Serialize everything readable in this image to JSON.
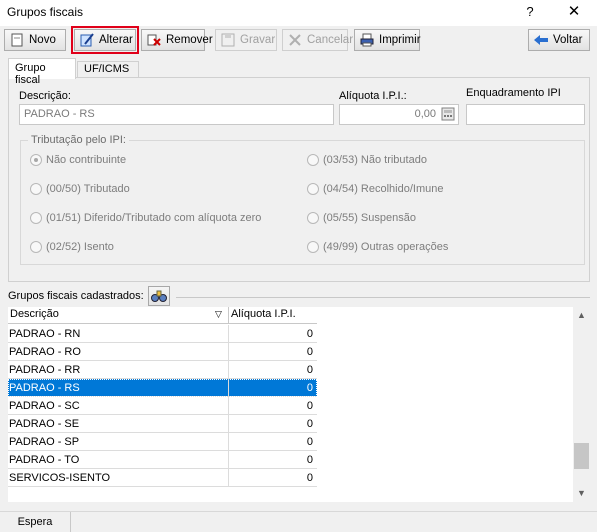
{
  "window": {
    "title": "Grupos fiscais",
    "help": "?",
    "close": "✕"
  },
  "toolbar": {
    "novo": "Novo",
    "alterar": "Alterar",
    "remover": "Remover",
    "gravar": "Gravar",
    "cancelar": "Cancelar",
    "imprimir": "Imprimir",
    "voltar": "Voltar"
  },
  "tabs": [
    "Grupo fiscal",
    "UF/ICMS"
  ],
  "form": {
    "descricao_label": "Descrição:",
    "descricao_value": "PADRAO - RS",
    "aliquota_label": "Alíquota I.P.I.:",
    "aliquota_value": "0,00",
    "enquadramento_label": "Enquadramento IPI",
    "enquadramento_value": ""
  },
  "tributacao": {
    "title": "Tributação pelo IPI:",
    "options": [
      "Não contribuinte",
      "(00/50) Tributado",
      "(01/51) Diferido/Tributado com alíquota zero",
      "(02/52) Isento",
      "(03/53) Não tributado",
      "(04/54) Recolhido/Imune",
      "(05/55) Suspensão",
      "(49/99) Outras operações"
    ],
    "selected": "Não contribuinte"
  },
  "grid": {
    "section_label": "Grupos fiscais cadastrados:",
    "headers": [
      "Descrição",
      "Alíquota I.P.I."
    ],
    "rows": [
      [
        "PADRAO - RN",
        "0"
      ],
      [
        "PADRAO - RO",
        "0"
      ],
      [
        "PADRAO - RR",
        "0"
      ],
      [
        "PADRAO - RS",
        "0"
      ],
      [
        "PADRAO - SC",
        "0"
      ],
      [
        "PADRAO - SE",
        "0"
      ],
      [
        "PADRAO - SP",
        "0"
      ],
      [
        "PADRAO - TO",
        "0"
      ],
      [
        "SERVICOS-ISENTO",
        "0"
      ]
    ],
    "selected_row": "PADRAO - RS"
  },
  "status": {
    "text": "Espera"
  },
  "colors": {
    "selection": "#0078d7",
    "highlight_border": "#e0001a"
  }
}
